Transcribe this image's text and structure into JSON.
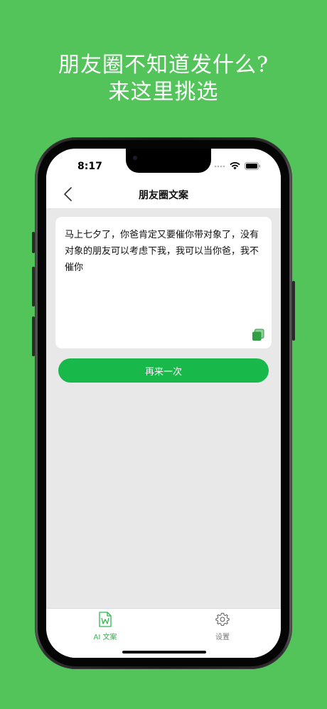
{
  "promo": {
    "line1": "朋友圈不知道发什么?",
    "line2": "来这里挑选"
  },
  "status": {
    "time": "8:17"
  },
  "navbar": {
    "title": "朋友圈文案"
  },
  "content": {
    "text": "马上七夕了，你爸肯定又要催你带对象了，没有对象的朋友可以考虑下我，我可以当你爸，我不催你"
  },
  "actions": {
    "again_label": "再来一次"
  },
  "tabbar": {
    "items": [
      {
        "label": "AI 文案",
        "icon": "document-w-icon",
        "active": true
      },
      {
        "label": "设置",
        "icon": "gear-icon",
        "active": false
      }
    ]
  },
  "colors": {
    "background": "#52C45A",
    "primary": "#19B84A",
    "tab_active": "#2eb84a"
  }
}
